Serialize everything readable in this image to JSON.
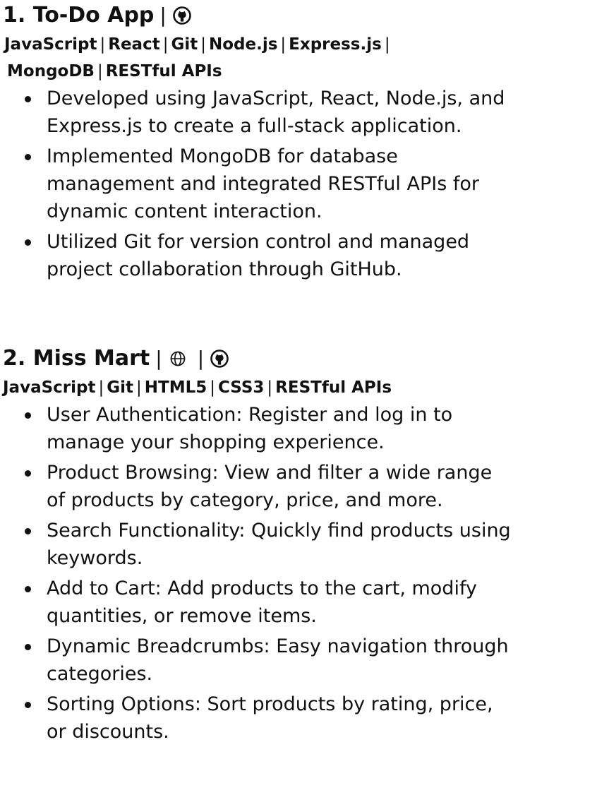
{
  "projects": [
    {
      "number": "1.",
      "title": "To-Do App",
      "separator": "|",
      "links": [
        {
          "icon": "github-icon"
        }
      ],
      "tech_lines": [
        [
          "JavaScript",
          "React",
          "Git",
          "Node.js",
          "Express.js",
          ""
        ],
        [
          "MongoDB",
          "RESTful APIs"
        ]
      ],
      "bullets": [
        [
          "Developed using JavaScript, React, Node.js, and",
          "Express.js to create a full-stack application."
        ],
        [
          "Implemented MongoDB for database",
          "management and integrated RESTful APIs for",
          "dynamic content interaction."
        ],
        [
          "Utilized Git for version control and managed",
          "project collaboration through GitHub."
        ]
      ]
    },
    {
      "number": "2.",
      "title": "Miss Mart",
      "separator": "|",
      "links": [
        {
          "icon": "globe-icon"
        },
        {
          "icon": "github-icon"
        }
      ],
      "tech_lines": [
        [
          "JavaScript",
          "Git",
          "HTML5",
          "CSS3",
          "RESTful APIs"
        ]
      ],
      "bullets": [
        [
          "User Authentication: Register and log in to",
          "manage your shopping experience."
        ],
        [
          "Product Browsing: View and filter a wide range",
          "of products by category, price, and more."
        ],
        [
          "Search Functionality: Quickly find products using",
          "keywords."
        ],
        [
          "Add to Cart: Add products to the cart, modify",
          "quantities, or remove items."
        ],
        [
          "Dynamic Breadcrumbs: Easy navigation through",
          "categories."
        ],
        [
          "Sorting Options: Sort products by rating, price,",
          "or discounts."
        ]
      ]
    }
  ]
}
